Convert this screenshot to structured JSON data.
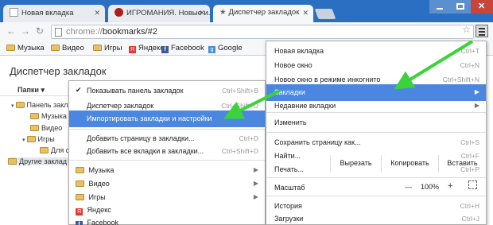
{
  "tabs": [
    {
      "label": "Новая вкладка",
      "active": false
    },
    {
      "label": "ИГРОМАНИЯ. Новые и...",
      "active": false
    },
    {
      "label": "Диспетчер закладок",
      "active": true
    }
  ],
  "omnibox": {
    "scheme": "chrome://",
    "rest": "bookmarks/#2"
  },
  "bookmarks_bar": [
    "Музыка",
    "Видео",
    "Игры",
    "Яндекс",
    "Facebook",
    "Google"
  ],
  "page": {
    "title": "Диспетчер закладок",
    "folders_button": "Папки ▾",
    "tree": [
      "Панель заклад",
      "Музыка",
      "Видео",
      "Игры",
      "Для сa",
      "Другие заклад"
    ]
  },
  "submenu": {
    "items": [
      {
        "label": "Показывать панель закладок",
        "shortcut": "Ctrl+Shift+B",
        "check": true
      },
      {
        "label": "Диспетчер закладок",
        "shortcut": "Ctrl+Shift+O"
      },
      {
        "label": "Импортировать закладки и настройки",
        "shortcut": "",
        "highlighted": true
      },
      {
        "label": "Добавить страницу в закладки...",
        "shortcut": "Ctrl+D"
      },
      {
        "label": "Добавить все вкладки в закладки...",
        "shortcut": "Ctrl+Shift+D"
      },
      {
        "label": "Музыка",
        "icon": "folder"
      },
      {
        "label": "Видео",
        "icon": "folder"
      },
      {
        "label": "Игры",
        "icon": "folder"
      },
      {
        "label": "Яндекс",
        "icon": "yandex"
      },
      {
        "label": "Facebook",
        "icon": "facebook"
      }
    ]
  },
  "main_menu": {
    "items": [
      {
        "label": "Новая вкладка",
        "shortcut": "Ctrl+T"
      },
      {
        "label": "Новое окно",
        "shortcut": "Ctrl+N"
      },
      {
        "label": "Новое окно в режиме инкогнито",
        "shortcut": "Ctrl+Shift+N"
      },
      {
        "label": "Закладки",
        "shortcut": "",
        "highlighted": true
      },
      {
        "label": "Недавние вкладки",
        "shortcut": ""
      },
      {
        "label": "Сохранить страницу как...",
        "shortcut": "Ctrl+S"
      },
      {
        "label": "Найти...",
        "shortcut": "Ctrl+F"
      },
      {
        "label": "Печать...",
        "shortcut": "Ctrl+P"
      },
      {
        "label": "История",
        "shortcut": "Ctrl+H"
      },
      {
        "label": "Загрузки",
        "shortcut": "Ctrl+J"
      }
    ],
    "edit_row": {
      "label": "Изменить",
      "cut": "Вырезать",
      "copy": "Копировать",
      "paste": "Вставить"
    },
    "zoom_row": {
      "label": "Масштаб",
      "minus": "—",
      "value": "100%",
      "plus": "+"
    }
  },
  "colors": {
    "highlight": "#4b87e0",
    "titlebar": "#2a6fc1",
    "arrow": "#3ad43a"
  }
}
